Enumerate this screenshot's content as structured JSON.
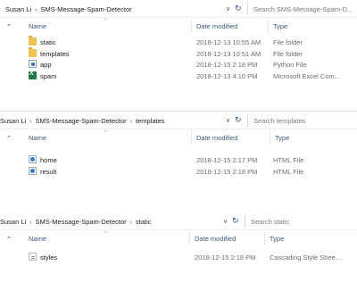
{
  "panes": [
    {
      "breadcrumb": [
        "Susan Li",
        "SMS-Message-Spam-Detector"
      ],
      "search_placeholder": "Search SMS-Message-Spam-D...",
      "columns": {
        "name": "Name",
        "date": "Date modified",
        "type": "Type"
      },
      "rows": [
        {
          "icon": "folder-icon",
          "name": "static",
          "date": "2018-12-13 10:55 AM",
          "type": "File folder"
        },
        {
          "icon": "folder-icon",
          "name": "templates",
          "date": "2018-12-13 10:51 AM",
          "type": "File folder"
        },
        {
          "icon": "python-file-icon",
          "name": "app",
          "date": "2018-12-15 2:18 PM",
          "type": "Python File"
        },
        {
          "icon": "excel-file-icon",
          "name": "spam",
          "date": "2018-12-13 4:10 PM",
          "type": "Microsoft Excel Com..."
        }
      ]
    },
    {
      "breadcrumb": [
        "Susan Li",
        "SMS-Message-Spam-Detector",
        "templates"
      ],
      "search_placeholder": "Search templates",
      "columns": {
        "name": "Name",
        "date": "Date modified",
        "type": "Type"
      },
      "rows": [
        {
          "icon": "html-file-icon",
          "name": "home",
          "date": "2018-12-15 2:17 PM",
          "type": "HTML File"
        },
        {
          "icon": "html-file-icon",
          "name": "result",
          "date": "2018-12-15 2:18 PM",
          "type": "HTML File"
        }
      ]
    },
    {
      "breadcrumb": [
        "Susan Li",
        "SMS-Message-Spam-Detector",
        "static"
      ],
      "search_placeholder": "Search static",
      "columns": {
        "name": "Name",
        "date": "Date modified",
        "type": "Type"
      },
      "rows": [
        {
          "icon": "css-file-icon",
          "name": "styles",
          "date": "2018-12-15 2:18 PM",
          "type": "Cascading Style Shee..."
        }
      ]
    }
  ],
  "icons": {
    "expand": "⌃",
    "dropdown": "∨",
    "refresh": "↻",
    "sort_caret": "^",
    "breadcrumb_sep": "›"
  }
}
